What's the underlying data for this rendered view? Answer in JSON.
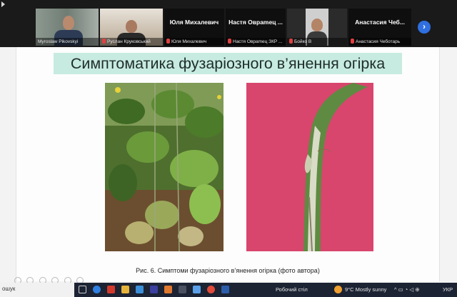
{
  "participants": [
    {
      "name": "",
      "label": "Myroslaw Pikovskyi",
      "type": "video",
      "active": true
    },
    {
      "name": "",
      "label": "Руслан Круковський",
      "type": "video",
      "active": false
    },
    {
      "name": "Юля Михалевич",
      "label": "Юля Михалевич",
      "type": "name",
      "active": false
    },
    {
      "name": "Настя Овраmец ...",
      "label": "Настя Овраmец ЗКР ...",
      "type": "name",
      "active": false
    },
    {
      "name": "",
      "label": "Бойко В",
      "type": "video",
      "active": false
    },
    {
      "name": "Анастасия Чеб...",
      "label": "Анастасия Чеботарь",
      "type": "name",
      "active": false
    }
  ],
  "slide": {
    "title": "Симптоматика фузаріозного в’янення огірка",
    "caption": "Рис. 6. Симптоми фузаріозного в’янення огірка (фото автора)"
  },
  "taskbar": {
    "search_text": "ошук",
    "desktop_label": "Робочий стіл",
    "weather": "9°C  Mostly sunny",
    "lang": "УКР"
  },
  "colors": {
    "title_bg": "#c7ebe0",
    "accent_blue": "#2f6fe0",
    "active_speaker": "#8fcf6b",
    "taskbar": "#1c2333"
  }
}
